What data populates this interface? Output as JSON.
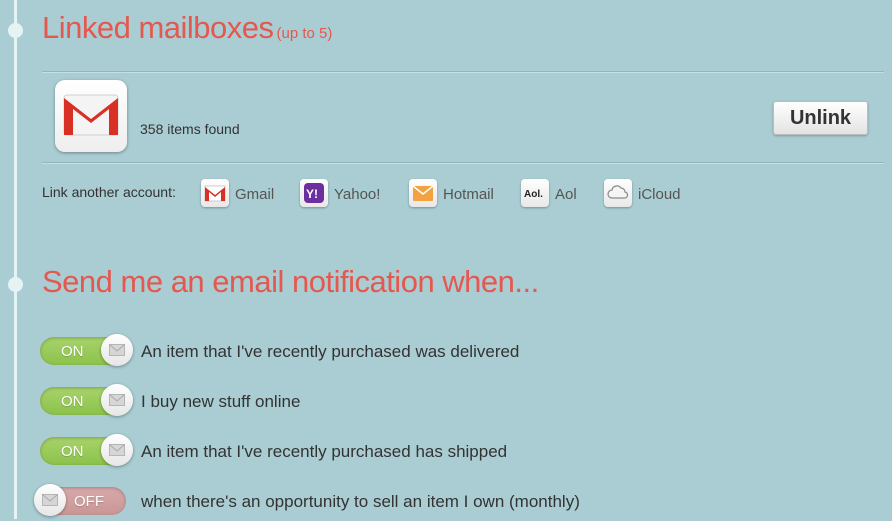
{
  "linked": {
    "title": "Linked mailboxes",
    "hint": "(up to 5)",
    "account": {
      "icon": "gmail-icon",
      "items_found": "358 items found",
      "unlink_label": "Unlink"
    }
  },
  "link_another": {
    "label": "Link another account:",
    "providers": [
      {
        "icon": "gmail-icon",
        "label": "Gmail"
      },
      {
        "icon": "yahoo-icon",
        "label": "Yahoo!"
      },
      {
        "icon": "hotmail-icon",
        "label": "Hotmail"
      },
      {
        "icon": "aol-icon",
        "label": "Aol"
      },
      {
        "icon": "icloud-icon",
        "label": "iCloud"
      }
    ]
  },
  "notifications": {
    "title": "Send me an email notification when...",
    "items": [
      {
        "state": "ON",
        "enabled": true,
        "label": "An item that I've recently purchased was delivered"
      },
      {
        "state": "ON",
        "enabled": true,
        "label": "I buy new stuff online"
      },
      {
        "state": "ON",
        "enabled": true,
        "label": "An item that I've recently purchased has shipped"
      },
      {
        "state": "OFF",
        "enabled": false,
        "label": "when there's an opportunity to sell an item I own (monthly)"
      }
    ]
  },
  "colors": {
    "background": "#a9cdd2",
    "heading": "#e4584f",
    "toggle_on": "#9bcb5b",
    "toggle_off": "#d0a0a0"
  }
}
